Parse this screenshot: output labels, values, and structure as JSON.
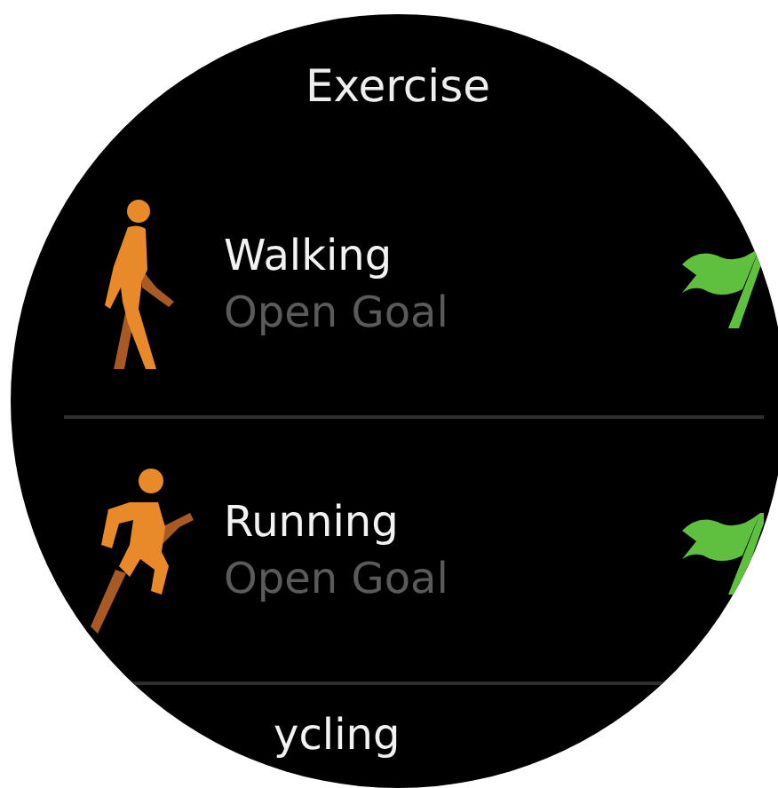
{
  "title": "Exercise",
  "items": [
    {
      "kind": "walking",
      "name": "Walking",
      "goal": "Open Goal",
      "flag": true
    },
    {
      "kind": "running",
      "name": "Running",
      "goal": "Open Goal",
      "flag": true
    },
    {
      "name": "ycling"
    }
  ]
}
